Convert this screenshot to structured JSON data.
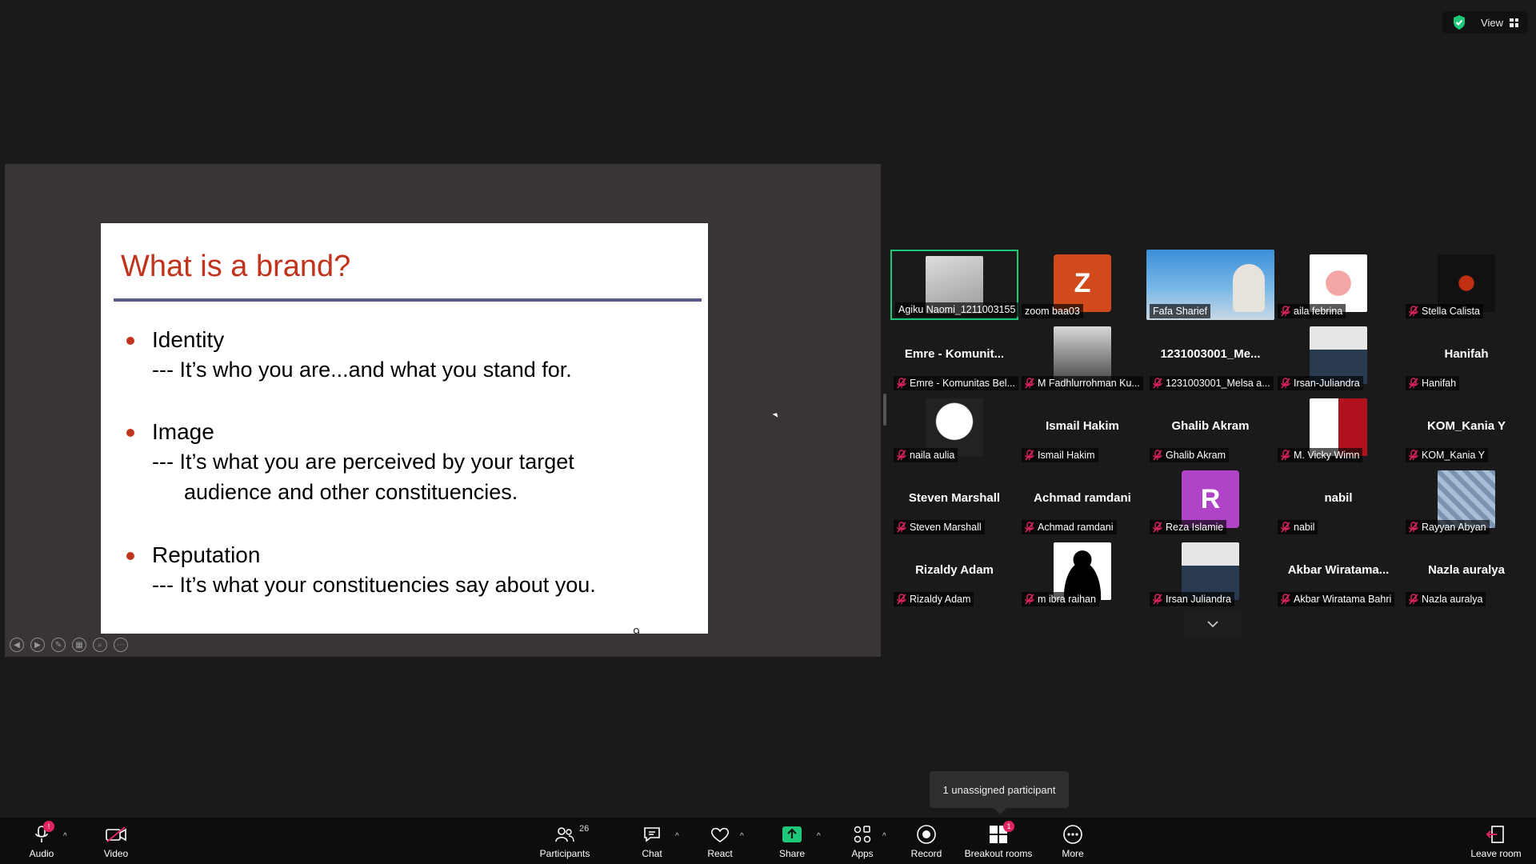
{
  "topbar": {
    "view_label": "View"
  },
  "slide": {
    "title": "What is a brand?",
    "bullets": [
      {
        "head": "Identity",
        "line1": "--- It’s who you are...and what you stand for.",
        "line2": ""
      },
      {
        "head": "Image",
        "line1": "--- It’s what you are perceived by your target",
        "line2": "audience and other constituencies."
      },
      {
        "head": "Reputation",
        "line1": "--- It’s what your constituencies say about you.",
        "line2": ""
      }
    ],
    "page_num": "9"
  },
  "participants": [
    {
      "name": "Agiku Naomi_1211003155",
      "big": "",
      "avatar": "photo-text",
      "mic_muted": false
    },
    {
      "name": "zoom baa03",
      "big": "",
      "avatar": "letter",
      "letter": "Z",
      "color": "#d04a1c",
      "mic_muted": false
    },
    {
      "name": "Fafa Sharief",
      "big": "",
      "avatar": "video",
      "mic_muted": false
    },
    {
      "name": "aila febrina",
      "big": "",
      "avatar": "flower",
      "mic_muted": true
    },
    {
      "name": "Stella Calista",
      "big": "",
      "avatar": "dark-logo",
      "mic_muted": true
    },
    {
      "name": "Emre - Komunitas Bel...",
      "big": "Emre - Komunit...",
      "avatar": "",
      "mic_muted": true
    },
    {
      "name": "M Fadhlurrohman Ku...",
      "big": "",
      "avatar": "photo-gray",
      "mic_muted": true
    },
    {
      "name": "1231003001_Melsa a...",
      "big": "1231003001_Me...",
      "avatar": "",
      "mic_muted": true
    },
    {
      "name": "Irsan-Juliandra",
      "big": "",
      "avatar": "photo-person",
      "mic_muted": true
    },
    {
      "name": "Hanifah",
      "big": "Hanifah",
      "avatar": "",
      "mic_muted": true
    },
    {
      "name": "naila aulia",
      "big": "",
      "avatar": "panda",
      "mic_muted": true
    },
    {
      "name": "Ismail Hakim",
      "big": "Ismail Hakim",
      "avatar": "",
      "mic_muted": true
    },
    {
      "name": "Ghalib Akram",
      "big": "Ghalib Akram",
      "avatar": "",
      "mic_muted": true
    },
    {
      "name": "M. Vicky Wimn",
      "big": "",
      "avatar": "logo-bw",
      "mic_muted": true
    },
    {
      "name": "KOM_Kania Y",
      "big": "KOM_Kania Y",
      "avatar": "",
      "mic_muted": true
    },
    {
      "name": "Steven Marshall",
      "big": "Steven Marshall",
      "avatar": "",
      "mic_muted": true
    },
    {
      "name": "Achmad ramdani",
      "big": "Achmad ramdani",
      "avatar": "",
      "mic_muted": true
    },
    {
      "name": "Reza Islamie",
      "big": "",
      "avatar": "letter",
      "letter": "R",
      "color": "#b044c8",
      "mic_muted": true
    },
    {
      "name": "nabil",
      "big": "nabil",
      "avatar": "",
      "mic_muted": true
    },
    {
      "name": "Rayyan Abyan",
      "big": "",
      "avatar": "pattern",
      "mic_muted": true
    },
    {
      "name": "Rizaldy Adam",
      "big": "Rizaldy Adam",
      "avatar": "",
      "mic_muted": true
    },
    {
      "name": "m ibra raihan",
      "big": "",
      "avatar": "silhouette",
      "mic_muted": true
    },
    {
      "name": "Irsan Juliandra",
      "big": "",
      "avatar": "photo-person",
      "mic_muted": true
    },
    {
      "name": "Akbar Wiratama Bahri",
      "big": "Akbar  Wiratama...",
      "avatar": "",
      "mic_muted": true
    },
    {
      "name": "Nazla auralya",
      "big": "Nazla auralya",
      "avatar": "",
      "mic_muted": true
    }
  ],
  "tooltip": "1 unassigned participant",
  "toolbar": {
    "audio": "Audio",
    "video": "Video",
    "participants": "Participants",
    "participants_count": "26",
    "chat": "Chat",
    "react": "React",
    "share": "Share",
    "apps": "Apps",
    "record": "Record",
    "breakout": "Breakout rooms",
    "breakout_badge": "1",
    "more": "More",
    "leave": "Leave room",
    "audio_badge": "!"
  },
  "colors": {
    "accent_green": "#1ec87a",
    "slide_title": "#c0341d",
    "share_green": "#1ec87a"
  }
}
